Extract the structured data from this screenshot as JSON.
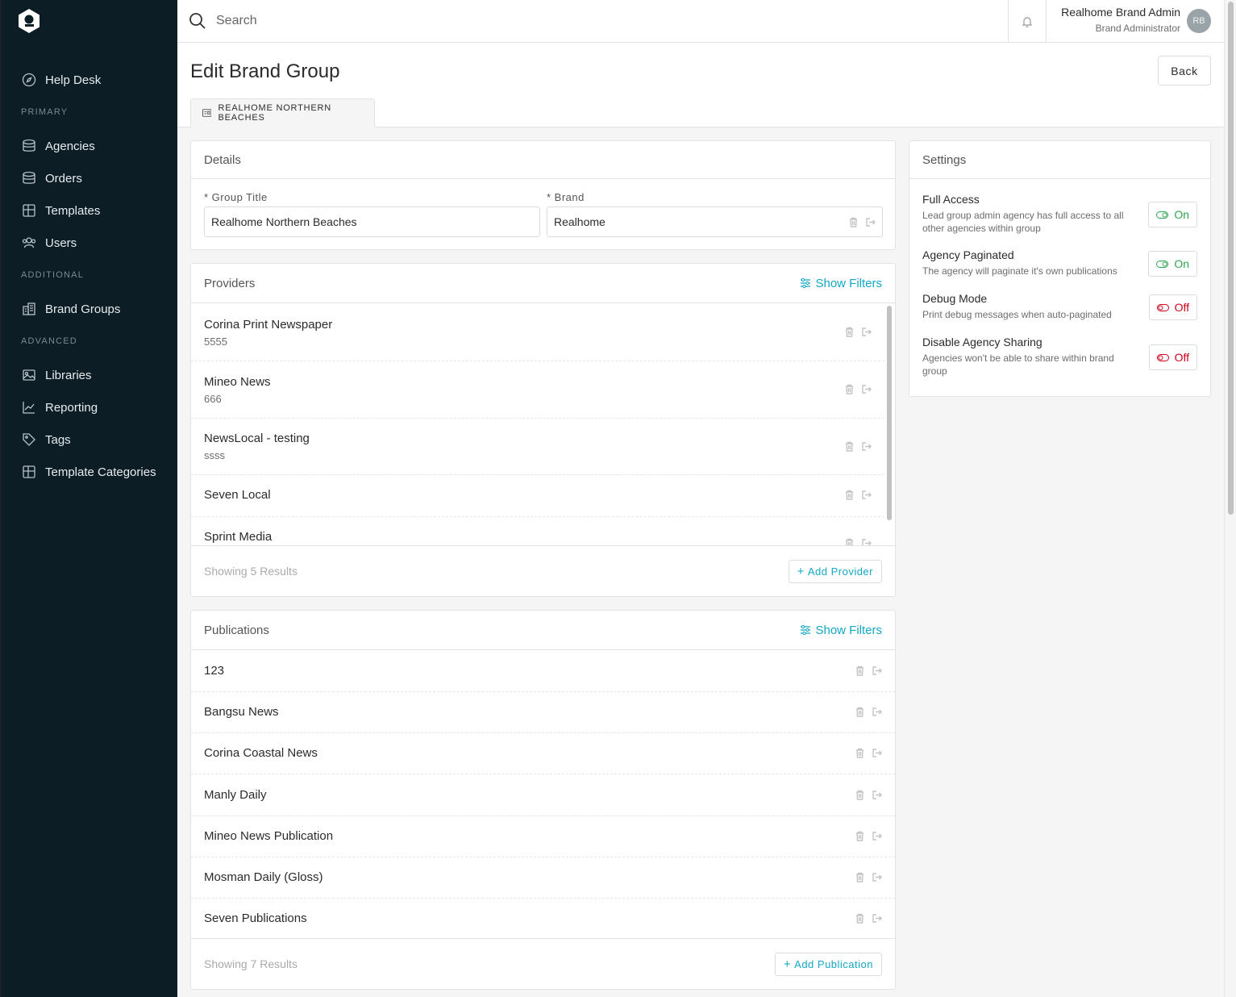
{
  "sidebar": {
    "items_top": [
      {
        "label": "Help Desk",
        "icon": "compass-icon"
      }
    ],
    "section_primary": "PRIMARY",
    "items_primary": [
      {
        "label": "Agencies",
        "icon": "database-icon"
      },
      {
        "label": "Orders",
        "icon": "database-icon"
      },
      {
        "label": "Templates",
        "icon": "grid-icon"
      },
      {
        "label": "Users",
        "icon": "users-icon"
      }
    ],
    "section_additional": "ADDITIONAL",
    "items_additional": [
      {
        "label": "Brand Groups",
        "icon": "buildings-icon"
      }
    ],
    "section_advanced": "ADVANCED",
    "items_advanced": [
      {
        "label": "Libraries",
        "icon": "image-icon"
      },
      {
        "label": "Reporting",
        "icon": "chart-line-icon"
      },
      {
        "label": "Tags",
        "icon": "tag-icon"
      },
      {
        "label": "Template Categories",
        "icon": "grid-icon"
      }
    ]
  },
  "topbar": {
    "search_placeholder": "Search",
    "user_name": "Realhome Brand Admin",
    "user_role": "Brand Administrator",
    "avatar_initials": "RB"
  },
  "page": {
    "title": "Edit Brand Group",
    "back_label": "Back",
    "tab_label": "REALHOME NORTHERN BEACHES"
  },
  "details": {
    "heading": "Details",
    "group_title_label": "* Group Title",
    "group_title_value": "Realhome Northern Beaches",
    "brand_label": "* Brand",
    "brand_value": "Realhome"
  },
  "providers": {
    "heading": "Providers",
    "show_filters": "Show Filters",
    "items": [
      {
        "name": "Corina Print Newspaper",
        "code": "5555"
      },
      {
        "name": "Mineo News",
        "code": "666"
      },
      {
        "name": "NewsLocal - testing",
        "code": "ssss"
      },
      {
        "name": "Seven Local",
        "code": ""
      },
      {
        "name": "Sprint Media",
        "code": ""
      }
    ],
    "results_text": "Showing 5 Results",
    "add_label": "Add Provider"
  },
  "publications": {
    "heading": "Publications",
    "show_filters": "Show Filters",
    "items": [
      {
        "name": "123"
      },
      {
        "name": "Bangsu News"
      },
      {
        "name": "Corina Coastal News"
      },
      {
        "name": "Manly Daily"
      },
      {
        "name": "Mineo News Publication"
      },
      {
        "name": "Mosman Daily (Gloss)"
      },
      {
        "name": "Seven Publications"
      }
    ],
    "results_text": "Showing 7 Results",
    "add_label": "Add Publication"
  },
  "settings": {
    "heading": "Settings",
    "items": [
      {
        "title": "Full Access",
        "desc": "Lead group admin agency has full access to all other agencies within group",
        "state": "On"
      },
      {
        "title": "Agency Paginated",
        "desc": "The agency will paginate it's own publications",
        "state": "On"
      },
      {
        "title": "Debug Mode",
        "desc": "Print debug messages when auto-paginated",
        "state": "Off"
      },
      {
        "title": "Disable Agency Sharing",
        "desc": "Agencies won't be able to share within brand group",
        "state": "Off"
      }
    ]
  },
  "colors": {
    "sidebar_bg": "#0d1d25",
    "accent": "#13a8c4",
    "on": "#2ea44f",
    "off": "#d0021b"
  }
}
